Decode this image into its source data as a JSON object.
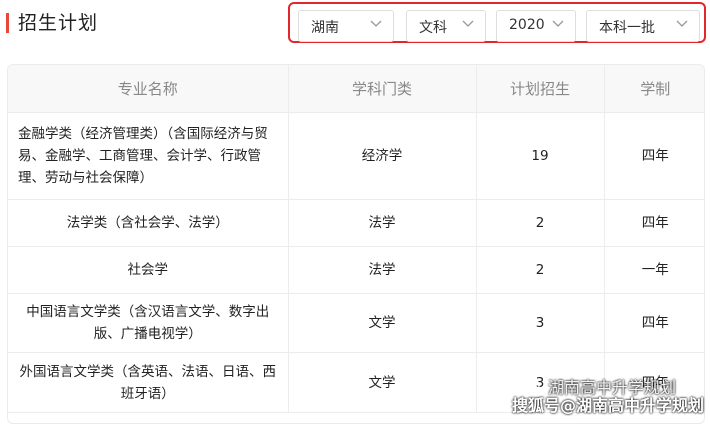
{
  "header": {
    "title": "招生计划"
  },
  "filters": [
    {
      "value": "湖南"
    },
    {
      "value": "文科"
    },
    {
      "value": "2020"
    },
    {
      "value": "本科一批"
    }
  ],
  "table": {
    "columns": [
      "专业名称",
      "学科门类",
      "计划招生",
      "学制"
    ],
    "rows": [
      {
        "major": "金融学类（经济管理类）（含国际经济与贸易、金融学、工商管理、会计学、行政管理、劳动与社会保障）",
        "category": "经济学",
        "plan": "19",
        "duration": "四年"
      },
      {
        "major": "法学类（含社会学、法学）",
        "category": "法学",
        "plan": "2",
        "duration": "四年"
      },
      {
        "major": "社会学",
        "category": "法学",
        "plan": "2",
        "duration": "一年"
      },
      {
        "major": "中国语言文学类（含汉语言文学、数字出版、广播电视学）",
        "category": "文学",
        "plan": "3",
        "duration": "四年"
      },
      {
        "major": "外国语言文学类（含英语、法语、日语、西班牙语）",
        "category": "文学",
        "plan": "3",
        "duration": "四年"
      }
    ]
  },
  "watermark": {
    "line1": "湖南高中升学规划",
    "line2": "搜狐号@湖南高中升学规划"
  }
}
